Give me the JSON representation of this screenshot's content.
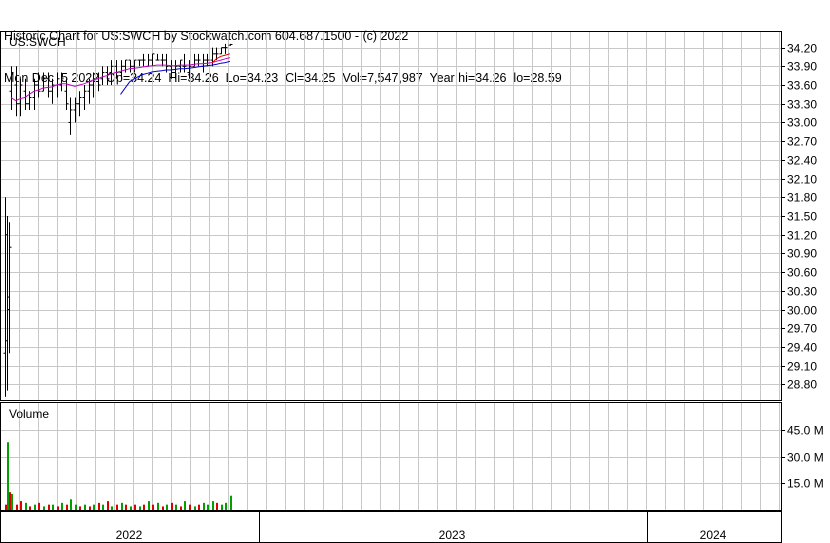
{
  "header": {
    "line1": "Historic Chart for US:SWCH by Stockwatch.com 604.687.1500 - (c) 2022",
    "line2": "Mon Dec  5 2022  Op=34.24  Hi=34.26  Lo=34.23  Cl=34.25  Vol=7,547,987  Year hi=34.26  lo=28.59"
  },
  "colors": {
    "grid": "#c8c8c8",
    "price_bar": "#000000",
    "ma_short": "#c800c8",
    "ma_long": "#0000d0",
    "ma_recent": "#e00000",
    "volume_up": "#00a000",
    "volume_down": "#e00000",
    "volume_flat": "#808080"
  },
  "chart_data": [
    {
      "type": "bar",
      "subtype": "ohlc",
      "symbol_label": "US:SWCH",
      "y_ticks": [
        "34.20",
        "33.90",
        "33.60",
        "33.30",
        "33.00",
        "32.70",
        "32.40",
        "32.10",
        "31.80",
        "31.50",
        "31.20",
        "30.90",
        "30.60",
        "30.30",
        "30.00",
        "29.70",
        "29.40",
        "29.10",
        "28.80"
      ],
      "y_tick_values": [
        34.2,
        33.9,
        33.6,
        33.3,
        33.0,
        32.7,
        32.4,
        32.1,
        31.8,
        31.5,
        31.2,
        30.9,
        30.6,
        30.3,
        30.0,
        29.7,
        29.4,
        29.1,
        28.8
      ],
      "ylim": [
        28.55,
        34.45
      ],
      "grid": true,
      "x_labels": [
        "2022",
        "2023",
        "2024"
      ],
      "series": [
        {
          "values": [
            [
              29.3,
              31.8,
              28.6,
              31.2
            ],
            [
              29.5,
              31.5,
              28.7,
              30.2
            ],
            [
              30.0,
              31.4,
              29.3,
              31.0
            ],
            [
              33.5,
              33.9,
              33.2,
              33.8
            ],
            [
              33.6,
              33.9,
              33.1,
              33.3
            ],
            [
              33.3,
              33.7,
              33.1,
              33.6
            ],
            [
              33.5,
              33.7,
              33.2,
              33.3
            ],
            [
              33.3,
              33.5,
              33.2,
              33.4
            ],
            [
              33.4,
              33.7,
              33.2,
              33.6
            ],
            [
              33.6,
              33.8,
              33.4,
              33.5
            ],
            [
              33.5,
              33.8,
              33.5,
              33.7
            ],
            [
              33.7,
              33.8,
              33.4,
              33.5
            ],
            [
              33.5,
              33.7,
              33.3,
              33.6
            ],
            [
              33.6,
              33.8,
              33.4,
              33.7
            ],
            [
              33.6,
              33.8,
              33.5,
              33.7
            ],
            [
              33.5,
              33.7,
              33.2,
              33.3
            ],
            [
              33.0,
              33.4,
              32.8,
              33.2
            ],
            [
              33.2,
              33.4,
              33.0,
              33.3
            ],
            [
              33.3,
              33.5,
              33.1,
              33.4
            ],
            [
              33.4,
              33.6,
              33.2,
              33.5
            ],
            [
              33.5,
              33.7,
              33.3,
              33.6
            ],
            [
              33.6,
              33.8,
              33.4,
              33.7
            ],
            [
              33.7,
              33.8,
              33.5,
              33.6
            ],
            [
              33.7,
              33.9,
              33.6,
              33.8
            ],
            [
              33.8,
              33.9,
              33.6,
              33.7
            ],
            [
              33.8,
              34.0,
              33.6,
              33.9
            ],
            [
              33.9,
              34.0,
              33.7,
              33.8
            ],
            [
              33.8,
              34.0,
              33.7,
              33.9
            ],
            [
              33.9,
              34.0,
              33.8,
              34.0
            ],
            [
              34.0,
              34.0,
              33.8,
              33.9
            ],
            [
              33.9,
              34.0,
              33.8,
              34.0
            ],
            [
              34.0,
              34.0,
              33.9,
              34.0
            ],
            [
              34.0,
              34.1,
              33.9,
              34.0
            ],
            [
              33.9,
              34.1,
              33.9,
              34.0
            ],
            [
              34.0,
              34.1,
              33.9,
              34.1
            ],
            [
              34.0,
              34.1,
              34.0,
              34.0
            ],
            [
              34.0,
              34.1,
              33.9,
              34.0
            ],
            [
              34.0,
              34.1,
              33.8,
              33.9
            ],
            [
              33.9,
              34.0,
              33.7,
              33.8
            ],
            [
              33.8,
              34.0,
              33.7,
              33.9
            ],
            [
              33.9,
              34.0,
              33.8,
              34.0
            ],
            [
              33.9,
              34.1,
              33.8,
              33.9
            ],
            [
              33.8,
              34.0,
              33.7,
              33.9
            ],
            [
              33.9,
              34.1,
              33.9,
              34.0
            ],
            [
              34.0,
              34.1,
              33.9,
              34.0
            ],
            [
              33.9,
              34.1,
              33.8,
              34.0
            ],
            [
              34.0,
              34.1,
              33.9,
              34.0
            ],
            [
              34.0,
              34.2,
              33.9,
              34.1
            ],
            [
              34.1,
              34.2,
              34.0,
              34.1
            ],
            [
              34.1,
              34.2,
              34.1,
              34.2
            ],
            [
              34.2,
              34.26,
              34.1,
              34.2
            ],
            [
              34.24,
              34.26,
              34.23,
              34.25
            ]
          ]
        },
        {
          "values": [
            null,
            null,
            null,
            33.4,
            33.35,
            33.38,
            33.4,
            33.45,
            33.5,
            33.52,
            33.55,
            33.56,
            33.57,
            33.6,
            33.62,
            33.62,
            33.6,
            33.58,
            33.6,
            33.62,
            33.65,
            33.68,
            33.7,
            33.73,
            33.75,
            33.78,
            33.8,
            33.82,
            33.84,
            33.86,
            33.87,
            33.88,
            33.89,
            33.9,
            33.91,
            33.92,
            33.92,
            33.92,
            33.91,
            33.91,
            33.92,
            33.92,
            33.92,
            33.93,
            33.94,
            33.94,
            33.95,
            33.96,
            33.98,
            34.0,
            34.02,
            34.04
          ]
        },
        {
          "values": [
            null,
            null,
            null,
            null,
            null,
            null,
            null,
            null,
            null,
            null,
            null,
            null,
            null,
            null,
            null,
            null,
            null,
            null,
            null,
            null,
            null,
            null,
            null,
            null,
            null,
            null,
            null,
            33.45,
            33.55,
            33.65,
            33.7,
            33.74,
            33.77,
            33.79,
            33.81,
            33.82,
            33.83,
            33.84,
            33.84,
            33.85,
            33.86,
            33.86,
            33.87,
            33.88,
            33.89,
            33.9,
            33.91,
            33.92,
            33.93,
            33.95,
            33.96,
            33.98
          ]
        },
        {
          "values": [
            null,
            null,
            null,
            null,
            null,
            null,
            null,
            null,
            null,
            null,
            null,
            null,
            null,
            null,
            null,
            null,
            null,
            null,
            null,
            null,
            null,
            null,
            null,
            null,
            null,
            null,
            null,
            null,
            null,
            null,
            null,
            null,
            null,
            null,
            null,
            null,
            null,
            null,
            null,
            null,
            null,
            null,
            null,
            null,
            null,
            null,
            null,
            33.95,
            34.02,
            34.06,
            34.08,
            34.1
          ]
        }
      ]
    },
    {
      "type": "bar",
      "title": "Volume",
      "y_ticks": [
        "45.0 M",
        "30.0 M",
        "15.0 M"
      ],
      "y_tick_values": [
        45,
        30,
        15
      ],
      "ylim": [
        0,
        60
      ],
      "grid": true,
      "series": [
        {
          "values": [
            3,
            38,
            10,
            9,
            3,
            5,
            4,
            2,
            3,
            4,
            2,
            3,
            3,
            2,
            4,
            3,
            6,
            3,
            2,
            3,
            2,
            3,
            4,
            3,
            5,
            2,
            3,
            4,
            3,
            2,
            3,
            2,
            3,
            5,
            3,
            4,
            2,
            3,
            4,
            3,
            2,
            5,
            3,
            2,
            3,
            4,
            3,
            5,
            4,
            3,
            4,
            8
          ],
          "directions": [
            "d",
            "u",
            "d",
            "u",
            "d",
            "d",
            "u",
            "d",
            "u",
            "d",
            "u",
            "d",
            "u",
            "d",
            "u",
            "d",
            "u",
            "u",
            "d",
            "u",
            "d",
            "u",
            "d",
            "u",
            "d",
            "u",
            "d",
            "u",
            "d",
            "u",
            "d",
            "u",
            "d",
            "u",
            "d",
            "u",
            "d",
            "u",
            "d",
            "u",
            "d",
            "u",
            "d",
            "u",
            "d",
            "u",
            "u",
            "u",
            "d",
            "u",
            "u",
            "u"
          ]
        }
      ]
    }
  ]
}
